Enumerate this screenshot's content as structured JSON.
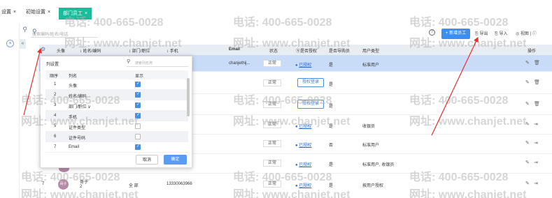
{
  "tabs": [
    {
      "label": "设置",
      "close": "×"
    },
    {
      "label": "初始设置",
      "close": "×"
    },
    {
      "label": "部门员工",
      "close": "×"
    }
  ],
  "toolbar": {
    "search_placeholder": "搜索编码/姓名/电话",
    "help": "?",
    "add_label": "+ 新增员工",
    "export_label": "导出",
    "import_label": "导入",
    "more_label": "◎ 视图 | ⓘ"
  },
  "columns": {
    "avatar": "头像",
    "name": "姓名/编码",
    "dept": "部门/职位",
    "phone": "手机",
    "email": "Email",
    "status": "状态",
    "authorized": "ⓠ是否授权",
    "is_guide": "是否导购员",
    "user_type": "用户类型",
    "ops": "操作"
  },
  "rows": [
    {
      "email": "chanjethij...",
      "status": "正常",
      "authorized": "已授权",
      "is_guide": "是",
      "user_type": "标准用户",
      "kind": "authorized"
    },
    {
      "status": "正常",
      "authorized": "授权登录",
      "is_guide": "是",
      "kind": "button"
    },
    {
      "status": "正常",
      "authorized": "授权登录",
      "is_guide": "是",
      "kind": "button"
    },
    {
      "status": "正常",
      "authorized": "已授权",
      "is_guide": "是",
      "user_type": "收银员",
      "kind": "authorized"
    },
    {
      "status": "正常",
      "authorized": "已授权",
      "is_guide": "否",
      "user_type": "标准用户",
      "kind": "authorized"
    },
    {
      "status": "正常",
      "authorized": "已授权",
      "is_guide": "是",
      "user_type": "标准用户, 收银员",
      "kind": "authorized"
    },
    {
      "index": "7",
      "avatar_text": "哥子",
      "name": "哥子",
      "code": "2",
      "dept": "全 部",
      "phone": "13330063966",
      "status": "正常",
      "authorized": "已授权",
      "is_guide": "是",
      "user_type": "按用户授权",
      "kind": "authorized"
    }
  ],
  "popup": {
    "title": "列设置",
    "search_placeholder": "搜索列名称",
    "head": {
      "index": "顺序",
      "name": "列名",
      "show": "显示"
    },
    "items": [
      {
        "index": "1",
        "name": "头像",
        "checked": true
      },
      {
        "index": "2",
        "name": "姓名/编码",
        "checked": true
      },
      {
        "index": "3",
        "name": "部门/职位 ∨",
        "checked": true
      },
      {
        "index": "4",
        "name": "手机",
        "checked": true
      },
      {
        "index": "5",
        "name": "证件类型",
        "checked": false
      },
      {
        "index": "6",
        "name": "证件号码",
        "checked": false
      },
      {
        "index": "7",
        "name": "Email",
        "checked": true
      }
    ],
    "cancel": "取消",
    "ok": "确定"
  },
  "watermark": {
    "phone": "电话: 400-665-0028",
    "site": "网址: www.chanjet.net"
  },
  "colors": {
    "accent": "#1bbc9b",
    "primary": "#3b8ff3",
    "selected_row": "#c8dcf8",
    "arrow": "#e0312f"
  }
}
